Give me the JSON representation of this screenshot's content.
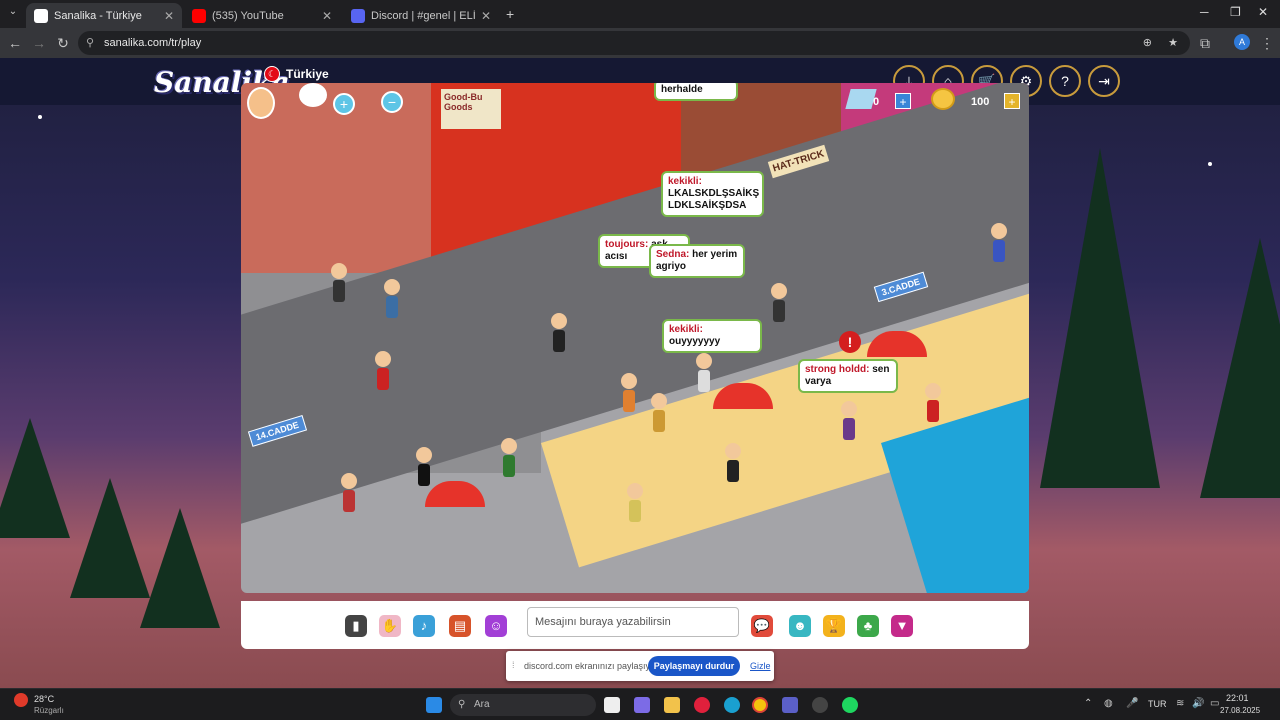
{
  "browser": {
    "tabs": [
      {
        "title": "Sanalika - Türkiye",
        "active": true,
        "favicon_color": "#ffffff"
      },
      {
        "title": "(535) YouTube",
        "active": false,
        "favicon_color": "#ff0000"
      },
      {
        "title": "Discord | #genel | ELİF VE B",
        "active": false,
        "favicon_color": "#5865f2"
      }
    ],
    "url": "sanalika.com/tr/play"
  },
  "site": {
    "logo": "Sanalika",
    "flag_glyph": "☾",
    "country": "Türkiye",
    "header_icons": [
      "download-icon",
      "home-icon",
      "shop-icon",
      "settings-icon",
      "help-icon",
      "logout-icon"
    ]
  },
  "game": {
    "diamonds": "0",
    "coins": "100",
    "signs": {
      "street_14": "14.CADDE",
      "street_3": "3.CADDE",
      "hat_trick": "HAT-TRICK",
      "good_goods": "Good-Bu Goods"
    },
    "chat_bubbles": [
      {
        "name": "",
        "text": "herhalde"
      },
      {
        "name": "kekikli:",
        "text": "LKALSKDLŞSAİKŞ LDKLSAİKŞDSA"
      },
      {
        "name": "toujours:",
        "text": "ask acısı"
      },
      {
        "name": "Sedna:",
        "text": "her yerim agriyo"
      },
      {
        "name": "kekikli:",
        "text": "ouyyyyyyy"
      },
      {
        "name": "strong holdd:",
        "text": "sen varya"
      }
    ],
    "chat_placeholder": "Mesajını buraya yazabilirsin",
    "toolbar_icons": [
      "phone-icon",
      "gesture-icon",
      "dance-icon",
      "bag-icon",
      "emote-icon",
      "chat-bubbles-icon",
      "robot-icon",
      "trophy-icon",
      "island-icon",
      "menu-heart-icon"
    ]
  },
  "share_bar": {
    "text": "discord.com ekranınızı paylaşıyor.",
    "stop_button": "Paylaşmayı durdur",
    "hide_link": "Gizle"
  },
  "taskbar": {
    "weather_temp": "28°C",
    "weather_desc": "Rüzgarlı",
    "search_placeholder": "Ara",
    "lang": "TUR",
    "time": "22:01",
    "date": "27.08.2025"
  }
}
